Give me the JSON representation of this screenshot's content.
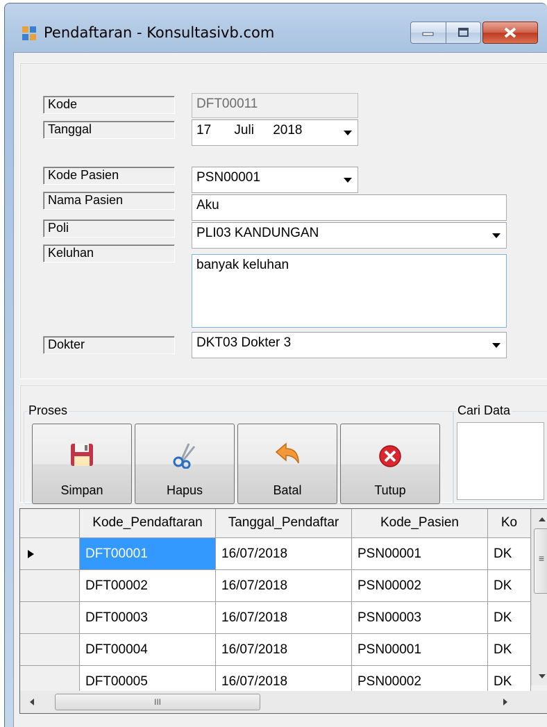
{
  "window": {
    "title": "Pendaftaran - Konsultasivb.com"
  },
  "form": {
    "kode_label": "Kode",
    "kode_value": "DFT00011",
    "tanggal_label": "Tanggal",
    "tanggal_day": "17",
    "tanggal_month": "Juli",
    "tanggal_year": "2018",
    "kode_pasien_label": "Kode Pasien",
    "kode_pasien_value": "PSN00001",
    "nama_pasien_label": "Nama Pasien",
    "nama_pasien_value": "Aku",
    "poli_label": "Poli",
    "poli_value": "PLI03  KANDUNGAN",
    "keluhan_label": "Keluhan",
    "keluhan_value": "banyak keluhan",
    "dokter_label": "Dokter",
    "dokter_value": "DKT03  Dokter 3"
  },
  "proses": {
    "title": "Proses",
    "simpan": "Simpan",
    "hapus": "Hapus",
    "batal": "Batal",
    "tutup": "Tutup"
  },
  "cari": {
    "title": "Cari Data"
  },
  "grid": {
    "columns": [
      "Kode_Pendaftaran",
      "Tanggal_Pendaftar",
      "Kode_Pasien",
      "Ko"
    ],
    "rows": [
      [
        "DFT00001",
        "16/07/2018",
        "PSN00001",
        "DK"
      ],
      [
        "DFT00002",
        "16/07/2018",
        "PSN00002",
        "DK"
      ],
      [
        "DFT00003",
        "16/07/2018",
        "PSN00003",
        "DK"
      ],
      [
        "DFT00004",
        "16/07/2018",
        "PSN00001",
        "DK"
      ],
      [
        "DFT00005",
        "16/07/2018",
        "PSN00002",
        "DK"
      ]
    ],
    "scroll_thumb_grip": "≡",
    "hscroll_thumb_grip": "III"
  },
  "colors": {
    "selection": "#3399ff",
    "close_button": "#c8452c"
  }
}
